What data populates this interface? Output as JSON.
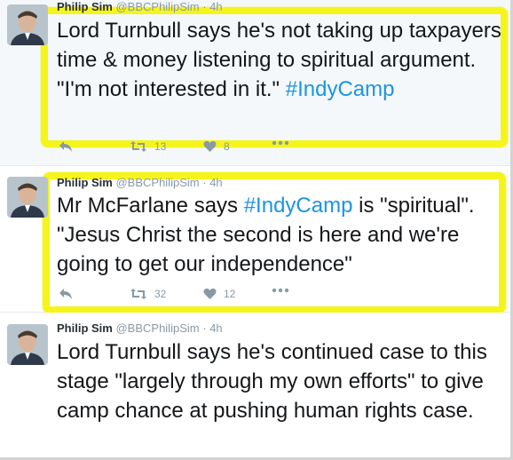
{
  "tweets": [
    {
      "author_name": "Philip Sim",
      "author_handle": "@BBCPhilipSim",
      "separator": "·",
      "time": "4h",
      "text_before": "Lord Turnbull says he's not taking up taxpayers time & money listening to spiritual argument. \"I'm not interested in it.\" ",
      "hashtag": "#IndyCamp",
      "text_after": "",
      "retweets": "13",
      "likes": "8",
      "highlighted": true
    },
    {
      "author_name": "Philip Sim",
      "author_handle": "@BBCPhilipSim",
      "separator": "·",
      "time": "4h",
      "text_before": "Mr McFarlane says ",
      "hashtag": "#IndyCamp",
      "text_after": " is \"spiritual\". \"Jesus Christ the second is here and we're going to get our independence\"",
      "retweets": "32",
      "likes": "12",
      "highlighted": true
    },
    {
      "author_name": "Philip Sim",
      "author_handle": "@BBCPhilipSim",
      "separator": "·",
      "time": "4h",
      "text_before": "Lord Turnbull says he's continued case to this stage \"largely through my own efforts\" to give camp chance at pushing human rights case.",
      "hashtag": "",
      "text_after": "",
      "retweets": "",
      "likes": "",
      "highlighted": false
    }
  ],
  "colors": {
    "highlight": "#f5f51c",
    "hashtag": "#1b95e0",
    "muted": "#8899a6",
    "selected_bg": "#f5f8fa"
  },
  "icons": {
    "reply": "reply-icon",
    "retweet": "retweet-icon",
    "like": "heart-icon",
    "more": "more-dots-icon"
  }
}
